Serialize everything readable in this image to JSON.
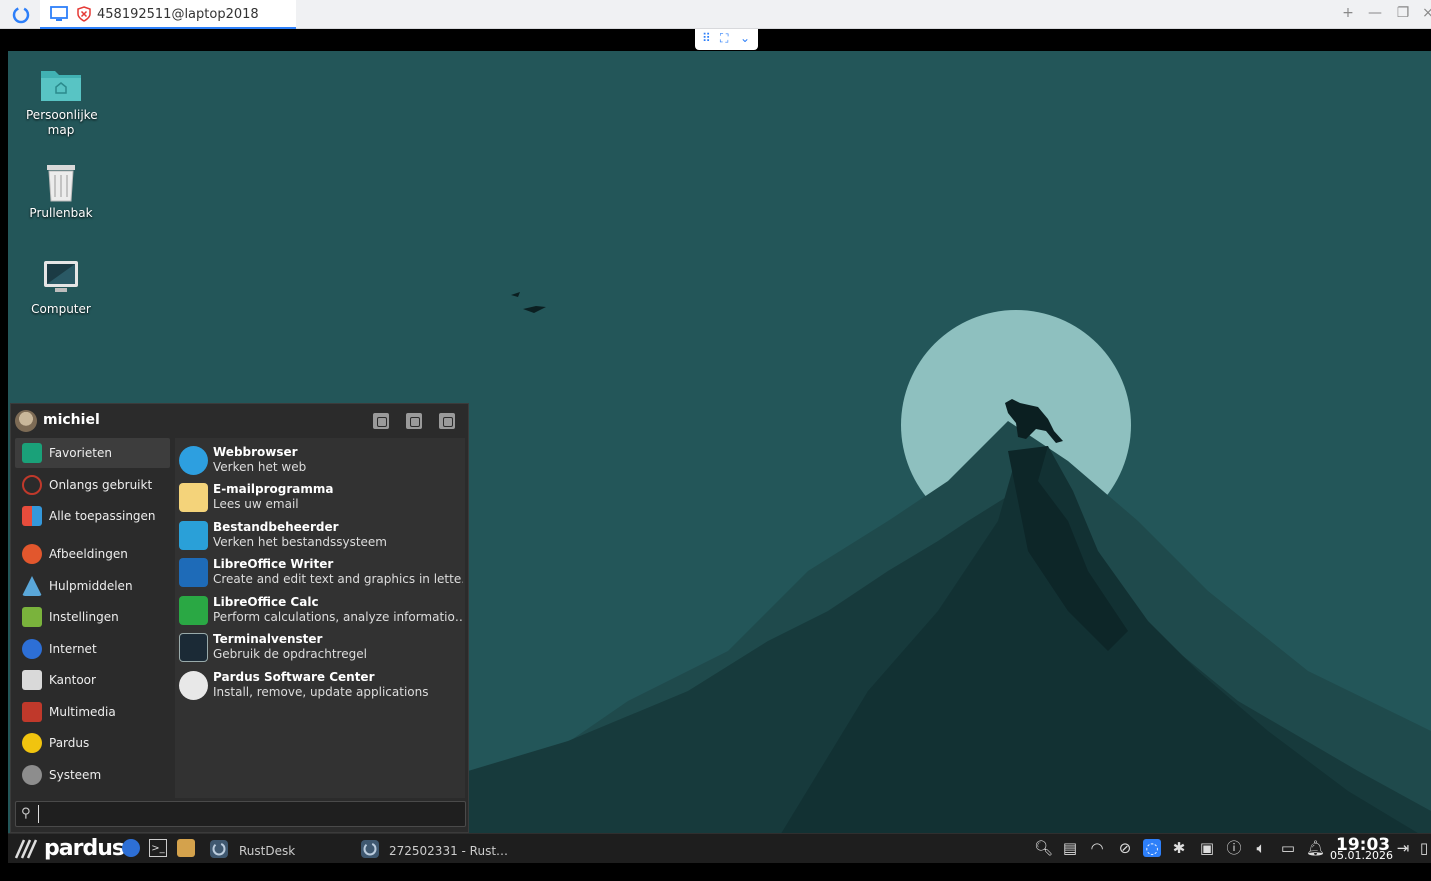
{
  "window": {
    "tab_title": "458192511@laptop2018",
    "controls": {
      "new_tab": "+",
      "minimize": "—",
      "restore": "❐",
      "close": "×"
    }
  },
  "desktop": {
    "icons": [
      {
        "label": "Persoonlijke map",
        "icon": "home-folder-icon"
      },
      {
        "label": "Prullenbak",
        "icon": "trash-icon"
      },
      {
        "label": "Computer",
        "icon": "computer-icon"
      }
    ]
  },
  "menu": {
    "user": "michiel",
    "categories": [
      {
        "label": "Favorieten",
        "icon": "favorites-icon",
        "color": "#1aa179",
        "active": true
      },
      {
        "label": "Onlangs gebruikt",
        "icon": "recent-icon",
        "color": "#c0392b"
      },
      {
        "label": "Alle toepassingen",
        "icon": "all-apps-icon",
        "color": "#3498db"
      },
      {
        "label": "Afbeeldingen",
        "icon": "graphics-icon",
        "color": "#e2572d"
      },
      {
        "label": "Hulpmiddelen",
        "icon": "accessories-icon",
        "color": "#5aa7d9"
      },
      {
        "label": "Instellingen",
        "icon": "settings-icon",
        "color": "#7ab33c"
      },
      {
        "label": "Internet",
        "icon": "internet-icon",
        "color": "#2d6fd6"
      },
      {
        "label": "Kantoor",
        "icon": "office-icon",
        "color": "#d9d9d9"
      },
      {
        "label": "Multimedia",
        "icon": "multimedia-icon",
        "color": "#c0392b"
      },
      {
        "label": "Pardus",
        "icon": "pardus-icon",
        "color": "#f1c40f"
      },
      {
        "label": "Systeem",
        "icon": "system-icon",
        "color": "#8d8d8d"
      }
    ],
    "apps": [
      {
        "name": "Webbrowser",
        "desc": "Verken het web",
        "icon": "web-browser-icon",
        "color": "#2d9fe0"
      },
      {
        "name": "E-mailprogramma",
        "desc": "Lees uw email",
        "icon": "mail-icon",
        "color": "#f4d37a"
      },
      {
        "name": "Bestandbeheerder",
        "desc": "Verken het bestandssysteem",
        "icon": "file-manager-icon",
        "color": "#2aa0d8"
      },
      {
        "name": "LibreOffice Writer",
        "desc": "Create and edit text and graphics in lette…",
        "icon": "writer-icon",
        "color": "#1e6bb8"
      },
      {
        "name": "LibreOffice Calc",
        "desc": "Perform calculations, analyze informatio…",
        "icon": "calc-icon",
        "color": "#2aa844"
      },
      {
        "name": "Terminalvenster",
        "desc": "Gebruik de opdrachtregel",
        "icon": "terminal-icon",
        "color": "#1b2a36"
      },
      {
        "name": "Pardus Software Center",
        "desc": "Install, remove, update applications",
        "icon": "software-center-icon",
        "color": "#e8e8e8"
      }
    ],
    "search_placeholder": ""
  },
  "taskbar": {
    "logo": "pardus",
    "tasks": [
      {
        "label": "RustDesk"
      },
      {
        "label": "272502331 - Rust…"
      }
    ],
    "clock": {
      "time": "19:03",
      "date": "05.01.2026"
    }
  }
}
